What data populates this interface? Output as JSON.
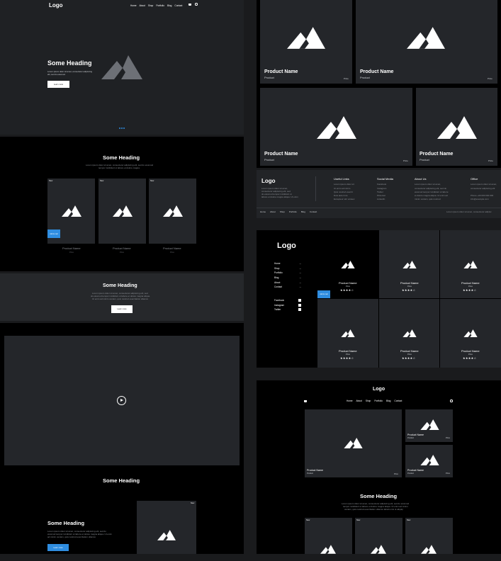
{
  "hero": {
    "logo": "Logo",
    "nav": [
      "Home",
      "About",
      "Shop",
      "Portfolio",
      "Blog",
      "Contact"
    ],
    "heading": "Some Heading",
    "text_line1": "Lorem ipsum dolor sit amet, consectetur adipiscing",
    "text_line2": "elit, sed do eiusmod",
    "button": "Learn more"
  },
  "section2": {
    "heading": "Some Heading",
    "text_line1": "Lorem ipsum dolor sit amet, consectetur adipiscing elit, sed do eiusmod",
    "text_line2": "tempor incididunt ut labore et dolore magna",
    "cards": [
      {
        "badge": "New",
        "name": "Product Name",
        "price": "Price",
        "button": "Add to cart"
      },
      {
        "badge": "New",
        "name": "Product Name",
        "price": "Price"
      },
      {
        "badge": "New",
        "name": "Product Name",
        "price": "Price"
      }
    ]
  },
  "section3": {
    "heading": "Some Heading",
    "text_line1": "Lorem ipsum dolor sit amet, consectetur adipiscing elit, sed",
    "text_line2": "do eiusmod tempor incididunt ut labore et dolore magna aliqua.",
    "text_line3": "Ut enim ad minim veniam, quis nostrud exercitation ullamco",
    "button": "Learn more"
  },
  "section4": {
    "heading": "Some Heading"
  },
  "section5": {
    "heading": "Some Heading",
    "text_line1": "Lorem ipsum dolor sit amet, consectetur adipiscing elit, sed do",
    "text_line2": "eiusmod tempor incididunt ut labore et dolore magna aliqua. Ut enim",
    "text_line3": "ad minim veniam, quis nostrud exercitation ullamco",
    "button": "Learn more",
    "card_badge": "New"
  },
  "grid": {
    "items": [
      {
        "name": "Product Name",
        "sub": "Product",
        "price": "Price"
      },
      {
        "name": "Product Name",
        "sub": "Product",
        "price": "Price"
      },
      {
        "name": "Product Name",
        "sub": "Product",
        "price": "Price"
      },
      {
        "name": "Product Name",
        "sub": "Product",
        "price": "Price"
      }
    ]
  },
  "footer": {
    "logo": "Logo",
    "about_lines": [
      "Lorem ipsum dolor sit amet,",
      "consectetur adipiscing elit, sed",
      "do eiusmod tempor incididunt ut",
      "labore et dolore magna aliqua. Ut enim"
    ],
    "cols": [
      {
        "title": "Useful Links",
        "items": [
          "Lorem ipsum dolor sit",
          "Ut enim ad minim",
          "Quis nostrud exercit",
          "Duis aute irure",
          "Excepteur sint occaec"
        ]
      },
      {
        "title": "Social Media",
        "items": [
          "Facebook",
          "Instagram",
          "Twitter",
          "Pinterest",
          "LinkedIn"
        ]
      },
      {
        "title": "About Us",
        "items": [
          "Lorem ipsum dolor sit amet,",
          "consectetur adipiscing elit, sed do",
          "eiusmod tempor incididunt ut labore",
          "et dolore magna aliqua. Ut enim ad",
          "minim veniam, quis nostrud"
        ]
      },
      {
        "title": "Office",
        "items": [
          "Lorem ipsum dolor sit amet,",
          "consectetur adipiscing elit",
          "",
          "Phone +00 000 000 000",
          "info@example.com"
        ]
      }
    ],
    "bottom_nav": [
      "Home",
      "About",
      "Shop",
      "Portfolio",
      "Blog",
      "Contact"
    ],
    "copyright": "Lorem ipsum dolor sit amet, consectetur adipisc"
  },
  "sidebar": {
    "logo": "Logo",
    "menu": [
      "Home",
      "Shop",
      "Portfolio",
      "Blog",
      "About",
      "Contact"
    ],
    "social": [
      "Facebook",
      "Instagram",
      "Twitter"
    ],
    "products": [
      {
        "name": "Product Name",
        "price": "Price",
        "stars": "★★★★☆"
      },
      {
        "name": "Product Name",
        "price": "Price",
        "stars": "★★★★☆"
      },
      {
        "name": "Product Name",
        "price": "Price",
        "stars": "★★★★☆"
      },
      {
        "name": "Product Name",
        "price": "Price",
        "stars": "★★★★☆"
      },
      {
        "name": "Product Name",
        "price": "Price",
        "stars": "★★★★☆"
      },
      {
        "name": "Product Name",
        "price": "Price",
        "stars": "★★★★☆"
      }
    ],
    "add_button": "Add to cart"
  },
  "shop2": {
    "logo": "Logo",
    "nav": [
      "Home",
      "About",
      "Shop",
      "Portfolio",
      "Blog",
      "Contact"
    ],
    "main": {
      "name": "Product Name",
      "sub": "Product",
      "price": "Price"
    },
    "side": [
      {
        "name": "Product Name",
        "sub": "Product",
        "price": "Price"
      },
      {
        "name": "Product Name",
        "sub": "Product",
        "price": "Price"
      }
    ],
    "heading": "Some Heading",
    "text_line1": "Lorem ipsum dolor sit amet, consectetur adipiscing elit, sed do eiusmod",
    "text_line2": "tempor incididunt ut labore et dolore magna aliqua. Ut enim ad minim",
    "text_line3": "veniam, quis nostrud exercitation ullamco laboris nisi ut aliquip",
    "badges": [
      "New",
      "New",
      "New"
    ]
  }
}
